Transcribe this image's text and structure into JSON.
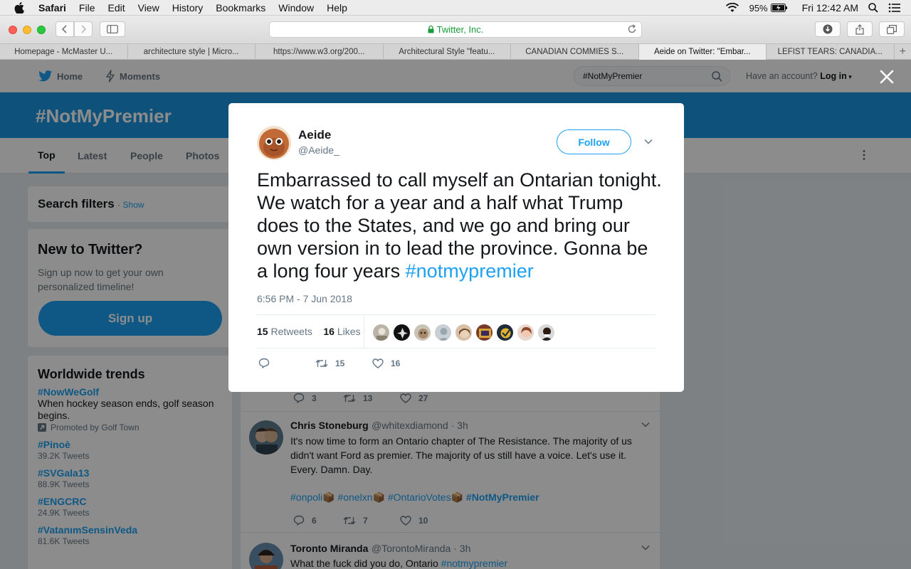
{
  "menubar": {
    "app": "Safari",
    "menus": [
      "File",
      "Edit",
      "View",
      "History",
      "Bookmarks",
      "Window",
      "Help"
    ],
    "battery": "95%",
    "clock": "Fri 12:42 AM"
  },
  "safari": {
    "address": "Twitter, Inc.",
    "tabs": [
      "Homepage - McMaster U...",
      "architecture style | Micro...",
      "https://www.w3.org/200...",
      "Architectural Style \"featu...",
      "CANADIAN COMMIES S...",
      "Aeide on Twitter: \"Embar...",
      "LEFIST TEARS: CANADIA..."
    ],
    "active_tab": 5
  },
  "twitter_nav": {
    "home": "Home",
    "moments": "Moments",
    "search_value": "#NotMyPremier",
    "account_prompt": "Have an account?",
    "login": "Log in"
  },
  "banner": {
    "title": "#NotMyPremier"
  },
  "subnav": {
    "tabs": [
      "Top",
      "Latest",
      "People",
      "Photos"
    ]
  },
  "sidebar": {
    "filters_title": "Search filters",
    "filters_show": "Show",
    "new_title": "New to Twitter?",
    "new_desc": "Sign up now to get your own personalized timeline!",
    "signup": "Sign up",
    "trends_title": "Worldwide trends",
    "trends": [
      {
        "name": "#NowWeGolf",
        "desc": "When hockey season ends, golf season begins.",
        "promo": "Promoted by Golf Town"
      },
      {
        "name": "#Pinoè",
        "count": "39.2K Tweets"
      },
      {
        "name": "#SVGala13",
        "count": "88.9K Tweets"
      },
      {
        "name": "#ENGCRC",
        "count": "24.9K Tweets"
      },
      {
        "name": "#VatanımSensinVeda",
        "count": "81.6K Tweets"
      }
    ]
  },
  "timeline": {
    "partial_actions": {
      "replies": "3",
      "retweets": "13",
      "likes": "27"
    },
    "tweets": [
      {
        "name": "Chris Stoneburg",
        "handle": "@whitexdiamond · 3h",
        "text": "It's now time to form an Ontario chapter of The Resistance. The majority of us didn't want Ford as premier. The majority of us still have a voice. Let's use it. Every. Damn. Day.",
        "tags": [
          "#onpoli",
          "#onelxn",
          "#OntarioVotes",
          "#NotMyPremier"
        ],
        "replies": "6",
        "retweets": "7",
        "likes": "10"
      },
      {
        "name": "Toronto Miranda",
        "handle": "@TorontoMiranda · 3h",
        "text": "What the fuck did you do, Ontario",
        "tag": "#notmypremier"
      }
    ]
  },
  "modal": {
    "name": "Aeide",
    "handle": "@Aeide_",
    "follow": "Follow",
    "text": "Embarrassed to call myself an Ontarian tonight. We watch for a year and a half what Trump does to the States, and we go and bring our own version in to lead the province. Gonna be a long four years",
    "hashtag": "#notmypremier",
    "time": "6:56 PM - 7 Jun 2018",
    "retweets_count": "15",
    "retweets_label": "Retweets",
    "likes_count": "16",
    "likes_label": "Likes",
    "action_retweets": "15",
    "action_likes": "16",
    "likers": 9
  }
}
